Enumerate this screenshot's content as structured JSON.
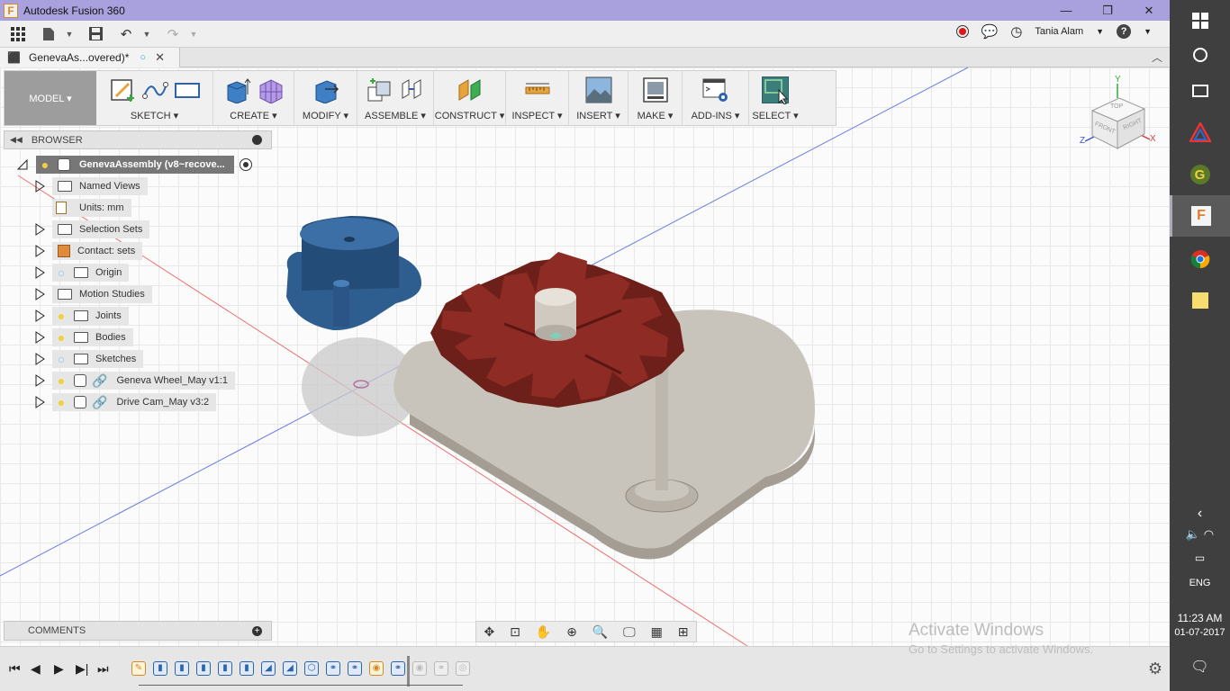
{
  "window": {
    "app_icon": "F",
    "title": "Autodesk Fusion 360",
    "minimize": "—",
    "maximize": "❐",
    "close": "✕"
  },
  "app_toolbar": {
    "user": "Tania Alam",
    "help": "?"
  },
  "doc_tab": {
    "label": "GenevaAs...overed)*"
  },
  "ribbon": {
    "workspace": "MODEL ▾",
    "groups": [
      {
        "label": "SKETCH ▾"
      },
      {
        "label": "CREATE ▾"
      },
      {
        "label": "MODIFY ▾"
      },
      {
        "label": "ASSEMBLE ▾"
      },
      {
        "label": "CONSTRUCT ▾"
      },
      {
        "label": "INSPECT ▾"
      },
      {
        "label": "INSERT ▾"
      },
      {
        "label": "MAKE ▾"
      },
      {
        "label": "ADD-INS ▾"
      },
      {
        "label": "SELECT ▾"
      }
    ]
  },
  "browser": {
    "title": "BROWSER",
    "root": "GenevaAssembly (v8~recove...",
    "items": [
      {
        "label": "Named Views"
      },
      {
        "label": "Units: mm"
      },
      {
        "label": "Selection Sets"
      },
      {
        "label": "Contact: sets"
      },
      {
        "label": "Origin"
      },
      {
        "label": "Motion Studies"
      },
      {
        "label": "Joints"
      },
      {
        "label": "Bodies"
      },
      {
        "label": "Sketches"
      },
      {
        "label": "Geneva Wheel_May v1:1"
      },
      {
        "label": "Drive Cam_May v3:2"
      }
    ]
  },
  "comments": {
    "title": "COMMENTS"
  },
  "viewcube": {
    "top": "TOP",
    "front": "FRONT",
    "right": "RIGHT",
    "axis_x": "X",
    "axis_y": "Y",
    "axis_z": "Z"
  },
  "watermark": {
    "line1": "Activate Windows",
    "line2": "Go to Settings to activate Windows."
  },
  "taskbar": {
    "lang": "ENG",
    "time": "11:23 AM",
    "date": "01-07-2017"
  },
  "colors": {
    "titlebar": "#a9a0de",
    "geneva_wheel": "#8e2b24",
    "drive_cam": "#2e5d8f",
    "base_plate": "#c9c4bb"
  }
}
